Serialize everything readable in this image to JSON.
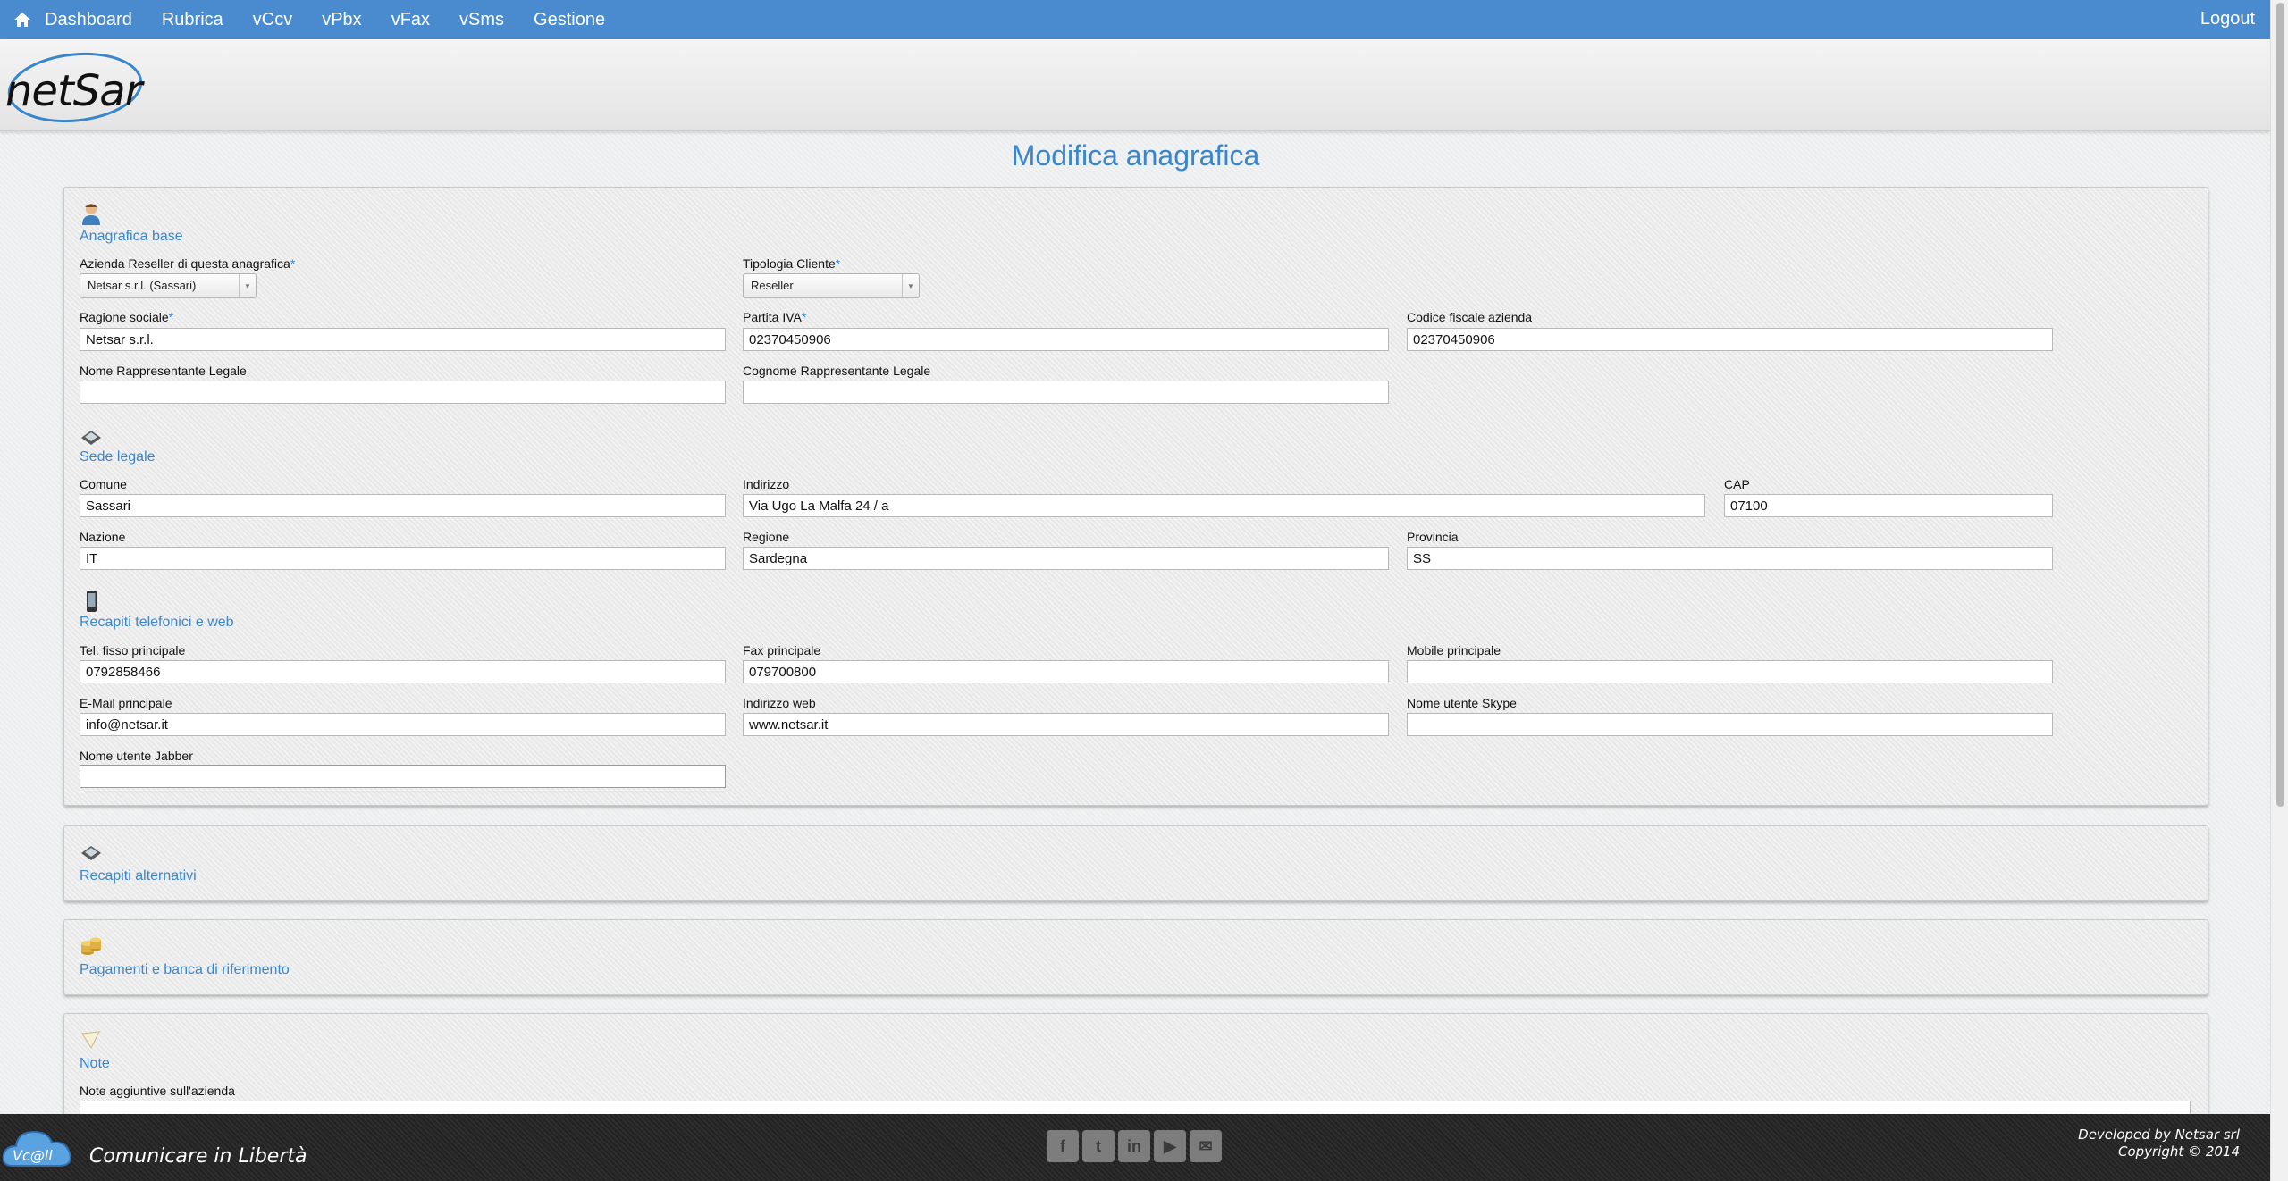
{
  "nav": {
    "items": [
      "Dashboard",
      "Rubrica",
      "vCcv",
      "vPbx",
      "vFax",
      "vSms",
      "Gestione"
    ],
    "logout": "Logout"
  },
  "brand": {
    "logo_text": "netSar"
  },
  "page_title": "Modifica anagrafica",
  "sections": {
    "base": {
      "title": "Anagrafica base",
      "reseller_label": "Azienda Reseller di questa anagrafica",
      "reseller_value": "Netsar s.r.l. (Sassari)",
      "tipologia_label": "Tipologia Cliente",
      "tipologia_value": "Reseller",
      "ragione_label": "Ragione sociale",
      "ragione_value": "Netsar s.r.l.",
      "piva_label": "Partita IVA",
      "piva_value": "02370450906",
      "cf_label": "Codice fiscale azienda",
      "cf_value": "02370450906",
      "nome_rapp_label": "Nome Rappresentante Legale",
      "nome_rapp_value": "",
      "cognome_rapp_label": "Cognome Rappresentante Legale",
      "cognome_rapp_value": ""
    },
    "sede": {
      "title": "Sede legale",
      "comune_label": "Comune",
      "comune_value": "Sassari",
      "indirizzo_label": "Indirizzo",
      "indirizzo_value": "Via Ugo La Malfa 24 / a",
      "cap_label": "CAP",
      "cap_value": "07100",
      "nazione_label": "Nazione",
      "nazione_value": "IT",
      "regione_label": "Regione",
      "regione_value": "Sardegna",
      "provincia_label": "Provincia",
      "provincia_value": "SS"
    },
    "recapiti": {
      "title": "Recapiti telefonici e web",
      "tel_label": "Tel. fisso principale",
      "tel_value": "0792858466",
      "fax_label": "Fax principale",
      "fax_value": "079700800",
      "mobile_label": "Mobile principale",
      "mobile_value": "",
      "email_label": "E-Mail principale",
      "email_value": "info@netsar.it",
      "web_label": "Indirizzo web",
      "web_value": "www.netsar.it",
      "skype_label": "Nome utente Skype",
      "skype_value": "",
      "jabber_label": "Nome utente Jabber",
      "jabber_value": ""
    },
    "alternativi": {
      "title": "Recapiti alternativi"
    },
    "pagamenti": {
      "title": "Pagamenti e banca di riferimento"
    },
    "note": {
      "title": "Note",
      "note_label": "Note aggiuntive sull'azienda"
    }
  },
  "footer": {
    "brand": "Vc@ll",
    "tagline": "Comunicare in Libertà",
    "social": [
      "facebook-icon",
      "twitter-icon",
      "linkedin-icon",
      "youtube-icon",
      "mail-icon"
    ],
    "credit_line1": "Developed by Netsar srl",
    "credit_line2": "Copyright © 2014"
  },
  "colors": {
    "nav_bg": "#4a8bd0",
    "accent": "#3a86cc",
    "footer_bg": "#262626"
  }
}
